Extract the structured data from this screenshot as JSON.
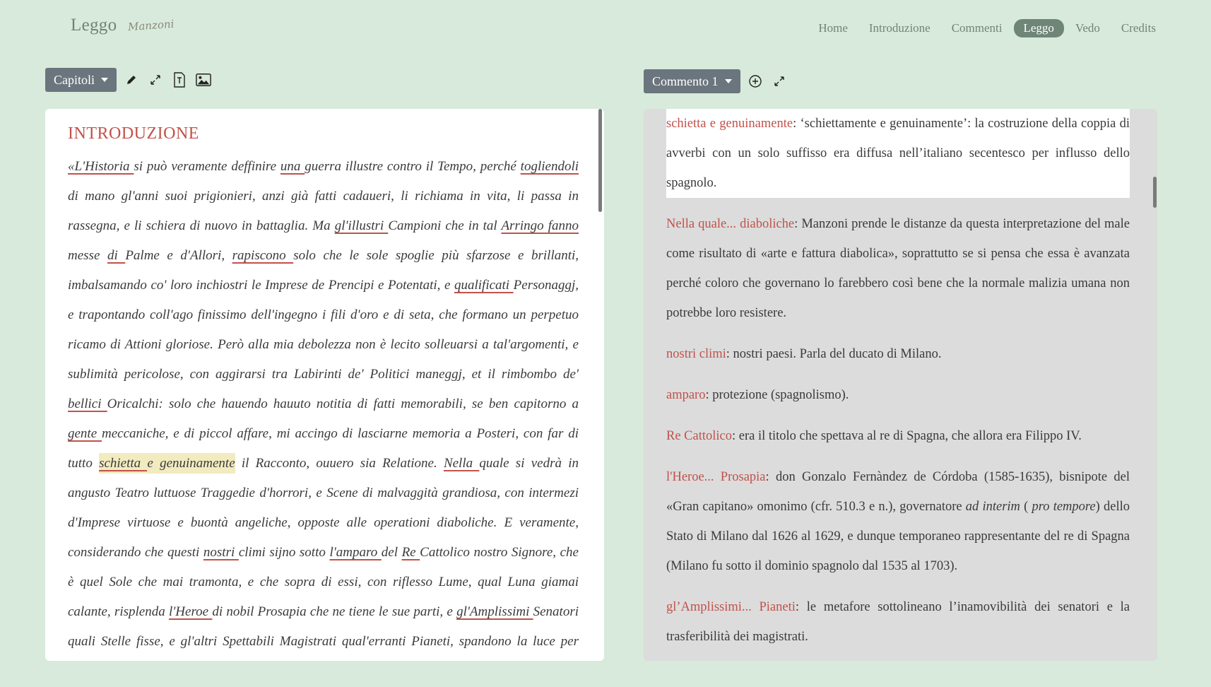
{
  "brand": {
    "name": "Leggo",
    "signature": "Manzoni"
  },
  "nav": [
    {
      "label": "Home",
      "active": false
    },
    {
      "label": "Introduzione",
      "active": false
    },
    {
      "label": "Commenti",
      "active": false
    },
    {
      "label": "Leggo",
      "active": true
    },
    {
      "label": "Vedo",
      "active": false
    },
    {
      "label": "Credits",
      "active": false
    }
  ],
  "left_toolbar": {
    "dropdown_label": "Capitoli",
    "icons": [
      "pencil-icon",
      "expand-icon",
      "text-file-icon",
      "image-icon"
    ]
  },
  "right_toolbar": {
    "dropdown_label": "Commento 1",
    "icons": [
      "add-circle-icon",
      "expand-icon"
    ]
  },
  "text": {
    "title": "INTRODUZIONE",
    "segments": [
      {
        "t": "«L'Historia ",
        "u": true
      },
      {
        "t": "si può veramente deffinire "
      },
      {
        "t": "una ",
        "u": true
      },
      {
        "t": "guerra illustre contro il Tempo, perché "
      },
      {
        "t": "togliendoli ",
        "u": true
      },
      {
        "t": "di mano gl'anni suoi prigionieri, anzi già fatti cadaueri, li richiama in vita, li passa in rassegna, e li schiera di nuovo in battaglia. Ma "
      },
      {
        "t": "gl'illustri ",
        "u": true
      },
      {
        "t": "Campioni che in tal "
      },
      {
        "t": "Arringo ",
        "u": true
      },
      {
        "t": "fanno ",
        "u": true
      },
      {
        "t": "messe "
      },
      {
        "t": "di ",
        "u": true
      },
      {
        "t": "Palme e d'Allori, "
      },
      {
        "t": "rapiscono ",
        "u": true
      },
      {
        "t": "solo che le sole spoglie più sfarzose e brillanti, imbalsamando co' loro inchiostri le Imprese de Prencipi e Potentati, e "
      },
      {
        "t": "qualificati ",
        "u": true
      },
      {
        "t": "Personaggj, e trapontando coll'ago finissimo dell'ingegno i fili d'oro e di seta, che formano un perpetuo ricamo di Attioni gloriose. Però alla mia debolezza non è lecito solleuarsi a tal'argomenti, e sublimità pericolose, con aggirarsi tra Labirinti de' Politici maneggj, et il rimbombo de' "
      },
      {
        "t": "bellici ",
        "u": true
      },
      {
        "t": "Oricalchi: solo che hauendo hauuto notitia di fatti memorabili, se ben capitorno a "
      },
      {
        "t": "gente ",
        "u": true
      },
      {
        "t": "meccaniche, e di piccol affare, mi accingo di lasciarne memoria a Posteri, con far di tutto "
      },
      {
        "t": "schietta ",
        "u": true,
        "h": true
      },
      {
        "t": "e genuinamente",
        "h": true
      },
      {
        "t": " il Racconto, ouuero sia Relatione. "
      },
      {
        "t": "Nella ",
        "u": true
      },
      {
        "t": "quale si vedrà in angusto Teatro luttuose Traggedie d'horrori, e Scene di malvaggità grandiosa, con intermezi d'Imprese virtuose e buontà angeliche, opposte alle operationi diaboliche. E veramente, considerando che questi "
      },
      {
        "t": "nostri ",
        "u": true
      },
      {
        "t": "climi sijno sotto "
      },
      {
        "t": "l'amparo ",
        "u": true
      },
      {
        "t": "del "
      },
      {
        "t": "Re ",
        "u": true
      },
      {
        "t": "Cattolico nostro Signore, che è quel Sole che mai tramonta, e che sopra di essi, con riflesso Lume, qual Luna giamai calante, risplenda "
      },
      {
        "t": "l'Heroe ",
        "u": true
      },
      {
        "t": "di nobil Prosapia che ne tiene le sue parti, e "
      },
      {
        "t": "gl'Amplissimi ",
        "u": true
      },
      {
        "t": "Senatori quali Stelle fisse, e gl'altri Spettabili Magistrati qual'erranti Pianeti, spandono la luce per ogni doue,"
      }
    ]
  },
  "notes": [
    {
      "term": "schietta e genuinamente",
      "first": true,
      "parts": [
        {
          "t": ": ‘schiettamente e genuinamente’: la costruzione della coppia di avverbi con un solo suffisso era diffusa nell’italiano secentesco per influsso dello spagnolo."
        }
      ]
    },
    {
      "term": "Nella quale... diaboliche",
      "parts": [
        {
          "t": ": Manzoni prende le distanze da questa interpretazione del male come risultato di «arte e fattura diabolica», soprattutto se si pensa che essa è avanzata perché coloro che governano lo farebbero così bene che la normale malizia umana non potrebbe loro resistere."
        }
      ]
    },
    {
      "term": "nostri climi",
      "parts": [
        {
          "t": ": nostri paesi. Parla del ducato di Milano."
        }
      ]
    },
    {
      "term": "amparo",
      "parts": [
        {
          "t": ": protezione (spagnolismo)."
        }
      ]
    },
    {
      "term": "Re Cattolico",
      "parts": [
        {
          "t": ": era il titolo che spettava al re di Spagna, che allora era Filippo IV."
        }
      ]
    },
    {
      "term": "l'Heroe... Prosapia",
      "parts": [
        {
          "t": ": don Gonzalo Fernàndez de Córdoba (1585-1635), bisnipote del «Gran capitano» omonimo (cfr. 510.3 e n.), governatore "
        },
        {
          "t": "ad interim",
          "i": true
        },
        {
          "t": " ( "
        },
        {
          "t": "pro tempore",
          "i": true
        },
        {
          "t": ") dello Stato di Milano dal 1626 al 1629, e dunque temporaneo rappresentante del re di Spagna (Milano fu sotto il dominio spagnolo dal 1535 al 1703)."
        }
      ]
    },
    {
      "term": "gl’Amplissimi... Pianeti",
      "parts": [
        {
          "t": ": le metafore sottolineano l’inamovibilità dei senatori e la trasferibilità dei magistrati."
        }
      ]
    }
  ],
  "colors": {
    "background": "#d8eadb",
    "accent_red": "#c0524b",
    "nav_green": "#6f8577",
    "button_gray": "#6b757d",
    "highlight": "#f2ebc0"
  }
}
